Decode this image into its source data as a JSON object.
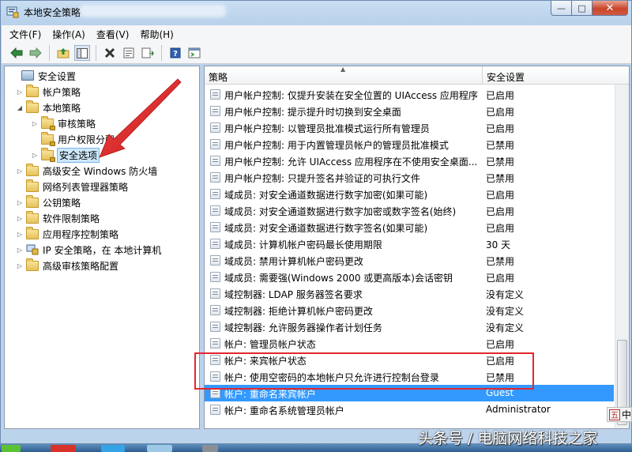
{
  "window": {
    "title": "本地安全策略",
    "colors": {
      "selection": "#3399ff",
      "highlight_box": "#e3262f"
    }
  },
  "menu": [
    "文件(F)",
    "操作(A)",
    "查看(V)",
    "帮助(H)"
  ],
  "toolbar_icons": [
    "back-icon",
    "forward-icon",
    "up-folder-icon",
    "show-tree-icon",
    "delete-icon",
    "properties-icon",
    "export-icon",
    "help-icon",
    "console-icon"
  ],
  "tree": [
    {
      "label": "安全设置",
      "icon": "computer-icon",
      "expander": ""
    },
    {
      "label": "帐户策略",
      "icon": "folder-icon",
      "expander": "▷"
    },
    {
      "label": "本地策略",
      "icon": "folder-icon",
      "expander": "◢"
    },
    {
      "label": "审核策略",
      "icon": "folder-lock-icon",
      "expander": "▷"
    },
    {
      "label": "用户权限分配",
      "icon": "folder-lock-icon",
      "expander": ""
    },
    {
      "label": "安全选项",
      "icon": "folder-lock-icon",
      "expander": "▷"
    },
    {
      "label": "高级安全 Windows 防火墙",
      "icon": "folder-icon",
      "expander": "▷"
    },
    {
      "label": "网络列表管理器策略",
      "icon": "folder-icon",
      "expander": ""
    },
    {
      "label": "公钥策略",
      "icon": "folder-icon",
      "expander": "▷"
    },
    {
      "label": "软件限制策略",
      "icon": "folder-icon",
      "expander": "▷"
    },
    {
      "label": "应用程序控制策略",
      "icon": "folder-icon",
      "expander": "▷"
    },
    {
      "label": "IP 安全策略，在 本地计算机",
      "icon": "ip-policy-icon",
      "expander": "▷"
    },
    {
      "label": "高级审核策略配置",
      "icon": "folder-icon",
      "expander": "▷"
    }
  ],
  "columns": {
    "policy": "策略",
    "setting": "安全设置"
  },
  "policies": [
    {
      "policy": "用户帐户控制: 仅提升安装在安全位置的 UIAccess 应用程序",
      "setting": "已启用"
    },
    {
      "policy": "用户帐户控制: 提示提升时切换到安全桌面",
      "setting": "已启用"
    },
    {
      "policy": "用户帐户控制: 以管理员批准模式运行所有管理员",
      "setting": "已启用"
    },
    {
      "policy": "用户帐户控制: 用于内置管理员帐户的管理员批准模式",
      "setting": "已禁用"
    },
    {
      "policy": "用户帐户控制: 允许 UIAccess 应用程序在不使用安全桌面...",
      "setting": "已禁用"
    },
    {
      "policy": "用户帐户控制: 只提升签名并验证的可执行文件",
      "setting": "已禁用"
    },
    {
      "policy": "域成员: 对安全通道数据进行数字加密(如果可能)",
      "setting": "已启用"
    },
    {
      "policy": "域成员: 对安全通道数据进行数字加密或数字签名(始终)",
      "setting": "已启用"
    },
    {
      "policy": "域成员: 对安全通道数据进行数字签名(如果可能)",
      "setting": "已启用"
    },
    {
      "policy": "域成员: 计算机帐户密码最长使用期限",
      "setting": "30 天"
    },
    {
      "policy": "域成员: 禁用计算机帐户密码更改",
      "setting": "已禁用"
    },
    {
      "policy": "域成员: 需要强(Windows 2000 或更高版本)会话密钥",
      "setting": "已启用"
    },
    {
      "policy": "域控制器: LDAP 服务器签名要求",
      "setting": "没有定义"
    },
    {
      "policy": "域控制器: 拒绝计算机帐户密码更改",
      "setting": "没有定义"
    },
    {
      "policy": "域控制器: 允许服务器操作者计划任务",
      "setting": "没有定义"
    },
    {
      "policy": "帐户: 管理员帐户状态",
      "setting": "已启用"
    },
    {
      "policy": "帐户: 来宾帐户状态",
      "setting": "已启用"
    },
    {
      "policy": "帐户: 使用空密码的本地帐户只允许进行控制台登录",
      "setting": "已禁用"
    },
    {
      "policy": "帐户: 重命名来宾帐户",
      "setting": "Guest"
    },
    {
      "policy": "帐户: 重命名系统管理员帐户",
      "setting": "Administrator"
    }
  ],
  "selected_row": 18,
  "ime": {
    "indicator": "五",
    "text": "中"
  },
  "watermark": "头条号 / 电脑网络科技之家"
}
